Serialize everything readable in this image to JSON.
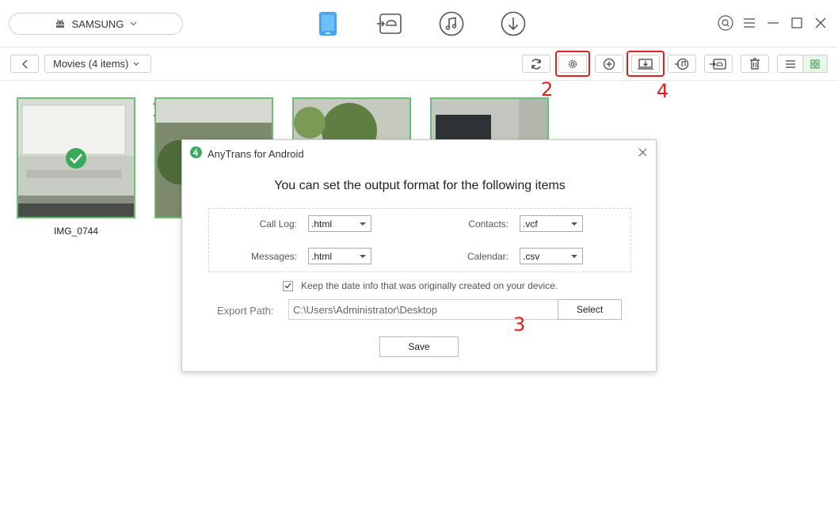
{
  "header": {
    "device_name": "SAMSUNG",
    "nav_icons": [
      "phone-icon",
      "android-transfer-icon",
      "music-icon",
      "download-icon"
    ],
    "window_controls": [
      "search-icon",
      "menu-icon",
      "minimize-icon",
      "maximize-icon",
      "close-icon"
    ]
  },
  "toolbar": {
    "folder_label": "Movies (4 items)",
    "buttons": [
      "refresh-icon",
      "settings-icon",
      "add-icon",
      "export-to-pc-icon",
      "export-to-itunes-icon",
      "export-to-device-icon",
      "delete-icon",
      "list-view-icon",
      "grid-view-icon"
    ]
  },
  "annotations": {
    "n1": "1",
    "n2": "2",
    "n3": "3",
    "n4": "4"
  },
  "thumbnails": {
    "items": [
      {
        "label": "IMG_0744",
        "selected": true
      },
      {
        "label": ""
      },
      {
        "label": ""
      },
      {
        "label": ""
      }
    ]
  },
  "dialog": {
    "title": "AnyTrans for Android",
    "heading": "You can set the output format for the following items",
    "formats": {
      "call_log_label": "Call Log:",
      "call_log_value": ".html",
      "messages_label": "Messages:",
      "messages_value": ".html",
      "contacts_label": "Contacts:",
      "contacts_value": ".vcf",
      "calendar_label": "Calendar:",
      "calendar_value": ".csv"
    },
    "keep_date_label": "Keep the date info that was originally created on your device.",
    "keep_date_checked": true,
    "export_path_label": "Export Path:",
    "export_path_value": "C:\\Users\\Administrator\\Desktop",
    "select_label": "Select",
    "save_label": "Save"
  },
  "colors": {
    "accent_green": "#6abf74",
    "brand_blue": "#4aa6e8",
    "annotation_red": "#e02020"
  }
}
